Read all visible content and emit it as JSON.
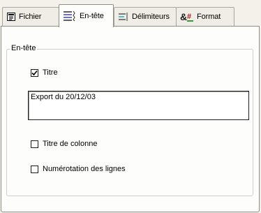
{
  "tabs": [
    {
      "label": "Fichier",
      "icon": "document-icon"
    },
    {
      "label": "En-tête",
      "icon": "header-lines-icon",
      "active": true
    },
    {
      "label": "Délimiteurs",
      "icon": "delimiter-lines-icon"
    },
    {
      "label": "Format",
      "icon": "format-icon"
    }
  ],
  "group": {
    "title": "En-tête",
    "titre": {
      "label": "Titre",
      "checked": true,
      "value": "Export du 20/12/03"
    },
    "titre_colonne": {
      "label": "Titre de colonne",
      "checked": false
    },
    "numerotation": {
      "label": "Numérotation des lignes",
      "checked": false
    }
  }
}
